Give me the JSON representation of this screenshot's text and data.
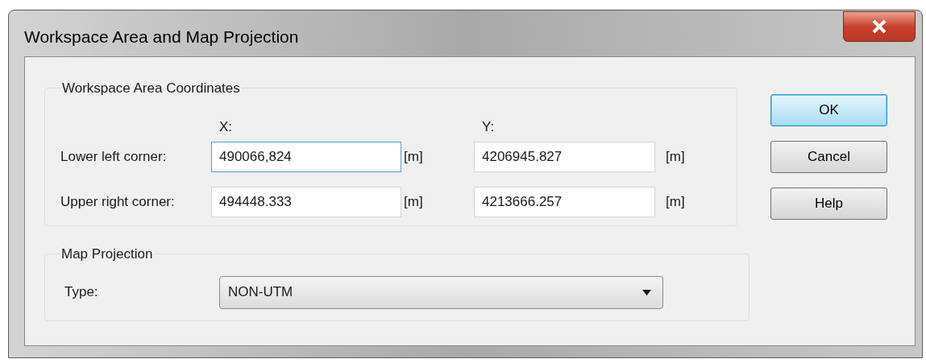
{
  "window": {
    "title": "Workspace Area and Map Projection"
  },
  "coordinates": {
    "title": "Workspace Area Coordinates",
    "column_headers": [
      "X:",
      "Y:"
    ],
    "rows": [
      {
        "label": "Lower left corner:",
        "x": {
          "value": "490066,824",
          "focused": true
        },
        "x_unit": "[m]",
        "y": {
          "value": "4206945.827",
          "focused": false
        },
        "y_unit": "[m]"
      },
      {
        "label": "Upper right corner:",
        "x": {
          "value": "494448.333",
          "focused": false
        },
        "x_unit": "[m]",
        "y": {
          "value": "4213666.257",
          "focused": false
        },
        "y_unit": "[m]"
      }
    ]
  },
  "projection": {
    "title": "Map Projection",
    "type_label": "Type:",
    "type_value": "NON-UTM"
  },
  "buttons": [
    {
      "label": "OK",
      "default": true
    },
    {
      "label": "Cancel",
      "default": false
    },
    {
      "label": "Help",
      "default": false
    }
  ]
}
